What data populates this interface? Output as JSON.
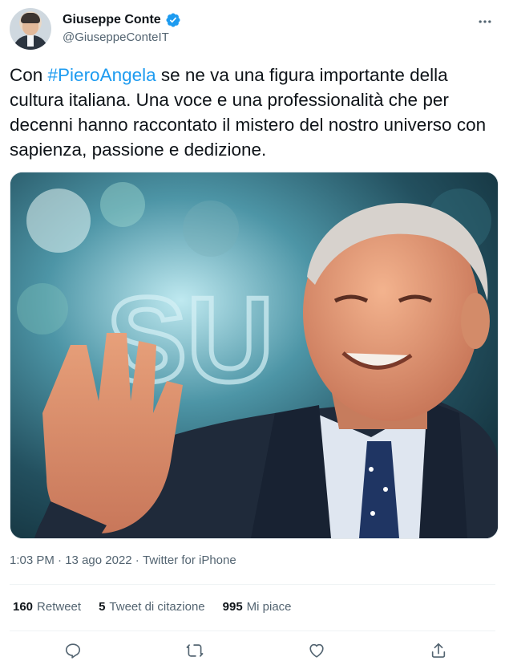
{
  "author": {
    "display_name": "Giuseppe Conte",
    "handle": "@GiuseppeConteIT",
    "verified": true
  },
  "tweet": {
    "text_before": "Con ",
    "hashtag": "#PieroAngela",
    "text_after": " se ne va una figura importante della cultura italiana. Una voce e una professionalità che per decenni hanno raccontato il mistero del nostro universo con sapienza, passione e dedizione.",
    "time": "1:03 PM",
    "date": "13 ago 2022",
    "source": "Twitter for iPhone",
    "separator": " · "
  },
  "media": {
    "background_letters": "SU"
  },
  "stats": {
    "retweets": {
      "count": "160",
      "label": "Retweet"
    },
    "quotes": {
      "count": "5",
      "label": "Tweet di citazione"
    },
    "likes": {
      "count": "995",
      "label": "Mi piace"
    }
  },
  "colors": {
    "accent": "#1d9bf0",
    "text": "#0f1419",
    "secondary": "#536471"
  },
  "icons": [
    "verified-badge-icon",
    "more-options-icon",
    "reply-icon",
    "retweet-icon",
    "like-icon",
    "share-icon"
  ]
}
